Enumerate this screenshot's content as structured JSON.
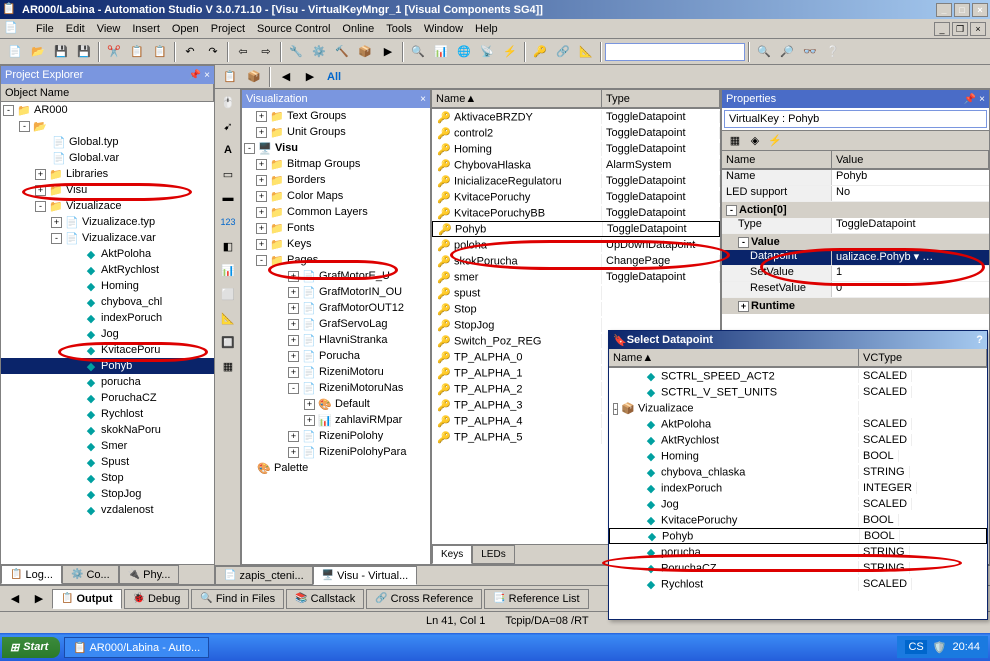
{
  "title": "AR000/Labina - Automation Studio V 3.0.71.10 - [Visu - VirtualKeyMngr_1 [Visual Components SG4]]",
  "menu": [
    "File",
    "Edit",
    "View",
    "Insert",
    "Open",
    "Project",
    "Source Control",
    "Online",
    "Tools",
    "Window",
    "Help"
  ],
  "projectExplorer": {
    "title": "Project Explorer",
    "colHeader": "Object Name",
    "root": "AR000",
    "items": [
      "Global.typ",
      "Global.var",
      "Libraries",
      "Visu"
    ],
    "viz": "Vizualizace",
    "vizChildren": [
      "Vizualizace.typ",
      "Vizualizace.var"
    ],
    "varChildren": [
      "AktPoloha",
      "AktRychlost",
      "Homing",
      "chybova_chl",
      "indexPoruch",
      "Jog",
      "KvitacePoru",
      "Pohyb",
      "porucha",
      "PoruchaCZ",
      "Rychlost",
      "skokNaPoru",
      "Smer",
      "Spust",
      "Stop",
      "StopJog",
      "vzdalenost"
    ],
    "tabs": [
      "Log...",
      "Co...",
      "Phy..."
    ]
  },
  "secToolbar": {
    "all": "All"
  },
  "vizPanel": {
    "title": "Visualization",
    "items": [
      "Text Groups",
      "Unit Groups"
    ],
    "visu": "Visu",
    "visuItems": [
      "Bitmap Groups",
      "Borders",
      "Color Maps",
      "Common Layers",
      "Fonts",
      "Keys",
      "Pages"
    ],
    "pages": [
      "GrafMotorE_U",
      "GrafMotorIN_OU",
      "GrafMotorOUT12",
      "GrafServoLag",
      "HlavniStranka",
      "Porucha",
      "RizeniMotoru",
      "RizeniMotoruNas"
    ],
    "subPages": [
      "Default",
      "zahlaviRMpar"
    ],
    "morePages": [
      "RizeniPolohy",
      "RizeniPolohyPara"
    ],
    "palette": "Palette"
  },
  "nameType": {
    "nameCol": "Name",
    "typeCol": "Type",
    "rows": [
      {
        "n": "AktivaceBRZDY",
        "t": "ToggleDatapoint"
      },
      {
        "n": "control2",
        "t": "ToggleDatapoint"
      },
      {
        "n": "Homing",
        "t": "ToggleDatapoint"
      },
      {
        "n": "ChybovaHlaska",
        "t": "AlarmSystem"
      },
      {
        "n": "InicializaceRegulatoru",
        "t": "ToggleDatapoint"
      },
      {
        "n": "KvitacePoruchy",
        "t": "ToggleDatapoint"
      },
      {
        "n": "KvitacePoruchyBB",
        "t": "ToggleDatapoint"
      },
      {
        "n": "Pohyb",
        "t": "ToggleDatapoint"
      },
      {
        "n": "poloha",
        "t": "UpDownDatapoint"
      },
      {
        "n": "skokPorucha",
        "t": "ChangePage"
      },
      {
        "n": "smer",
        "t": "ToggleDatapoint"
      },
      {
        "n": "spust",
        "t": ""
      },
      {
        "n": "Stop",
        "t": ""
      },
      {
        "n": "StopJog",
        "t": ""
      },
      {
        "n": "Switch_Poz_REG",
        "t": ""
      },
      {
        "n": "TP_ALPHA_0",
        "t": ""
      },
      {
        "n": "TP_ALPHA_1",
        "t": ""
      },
      {
        "n": "TP_ALPHA_2",
        "t": ""
      },
      {
        "n": "TP_ALPHA_3",
        "t": ""
      },
      {
        "n": "TP_ALPHA_4",
        "t": ""
      },
      {
        "n": "TP_ALPHA_5",
        "t": ""
      }
    ],
    "tabs": [
      "Keys",
      "LEDs"
    ]
  },
  "props": {
    "title": "Properties",
    "selector": "VirtualKey : Pohyb",
    "nameCol": "Name",
    "valCol": "Value",
    "rows": [
      {
        "k": "Name",
        "v": "Pohyb"
      },
      {
        "k": "LED support",
        "v": "No"
      }
    ],
    "actionGroup": "Action[0]",
    "actionRows": [
      {
        "k": "Type",
        "v": "ToggleDatapoint"
      }
    ],
    "valueGroup": "Value",
    "valueRows": [
      {
        "k": "Datapoint",
        "v": "ualizace.Pohyb"
      },
      {
        "k": "SetValue",
        "v": "1"
      },
      {
        "k": "ResetValue",
        "v": "0"
      }
    ],
    "runtime": "Runtime"
  },
  "selectDialog": {
    "title": "Select Datapoint",
    "nameCol": "Name",
    "typeCol": "VCType",
    "topRows": [
      {
        "n": "SCTRL_SPEED_ACT2",
        "t": "SCALED"
      },
      {
        "n": "SCTRL_V_SET_UNITS",
        "t": "SCALED"
      }
    ],
    "viz": "Vizualizace",
    "rows": [
      {
        "n": "AktPoloha",
        "t": "SCALED"
      },
      {
        "n": "AktRychlost",
        "t": "SCALED"
      },
      {
        "n": "Homing",
        "t": "BOOL"
      },
      {
        "n": "chybova_chlaska",
        "t": "STRING"
      },
      {
        "n": "indexPoruch",
        "t": "INTEGER"
      },
      {
        "n": "Jog",
        "t": "SCALED"
      },
      {
        "n": "KvitacePoruchy",
        "t": "BOOL"
      },
      {
        "n": "Pohyb",
        "t": "BOOL"
      },
      {
        "n": "porucha",
        "t": "STRING"
      },
      {
        "n": "PoruchaCZ",
        "t": "STRING"
      },
      {
        "n": "Rychlost",
        "t": "SCALED"
      }
    ]
  },
  "docTabs": [
    "zapis_cteni...",
    "Visu - Virtual..."
  ],
  "outputTabs": [
    "Output",
    "Debug",
    "Find in Files",
    "Callstack",
    "Cross Reference",
    "Reference List"
  ],
  "status": {
    "pos": "Ln 41, Col 1",
    "conn": "Tcpip/DA=08 /RT"
  },
  "taskbar": {
    "start": "Start",
    "task": "AR000/Labina - Auto...",
    "lang": "CS",
    "time": "20:44"
  }
}
